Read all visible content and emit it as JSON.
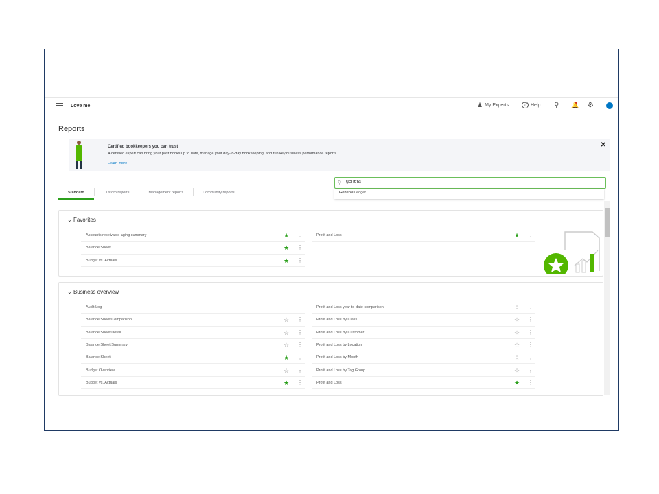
{
  "header": {
    "company": "Love me",
    "my_experts": "My Experts",
    "help": "Help"
  },
  "page_title": "Reports",
  "banner": {
    "title": "Certified bookkeepers you can trust",
    "body": "A certified expert can bring your past books up to date, manage your day-to-day bookkeeping, and run key business performance reports.",
    "link": "Learn more"
  },
  "tabs": [
    "Standard",
    "Custom reports",
    "Management reports",
    "Community reports"
  ],
  "search": {
    "value": "genera",
    "suggestion_bold": "General",
    "suggestion_rest": " Ledger"
  },
  "favorites": {
    "title": "Favorites",
    "left": [
      {
        "label": "Accounts receivable aging summary",
        "fav": true
      },
      {
        "label": "Balance Sheet",
        "fav": true
      },
      {
        "label": "Budget vs. Actuals",
        "fav": true
      }
    ],
    "right": [
      {
        "label": "Profit and Loss",
        "fav": true
      }
    ]
  },
  "business_overview": {
    "title": "Business overview",
    "left": [
      {
        "label": "Audit Log",
        "fav": null
      },
      {
        "label": "Balance Sheet Comparison",
        "fav": false
      },
      {
        "label": "Balance Sheet Detail",
        "fav": false
      },
      {
        "label": "Balance Sheet Summary",
        "fav": false
      },
      {
        "label": "Balance Sheet",
        "fav": true
      },
      {
        "label": "Budget Overview",
        "fav": false
      },
      {
        "label": "Budget vs. Actuals",
        "fav": true
      }
    ],
    "right": [
      {
        "label": "Profit and Loss year-to-date comparison",
        "fav": false
      },
      {
        "label": "Profit and Loss by Class",
        "fav": false
      },
      {
        "label": "Profit and Loss by Customer",
        "fav": false
      },
      {
        "label": "Profit and Loss by Location",
        "fav": false
      },
      {
        "label": "Profit and Loss by Month",
        "fav": false
      },
      {
        "label": "Profit and Loss by Tag Group",
        "fav": false
      },
      {
        "label": "Profit and Loss",
        "fav": true
      }
    ]
  },
  "colors": {
    "accent": "#2ca01c",
    "link": "#0077c5"
  }
}
